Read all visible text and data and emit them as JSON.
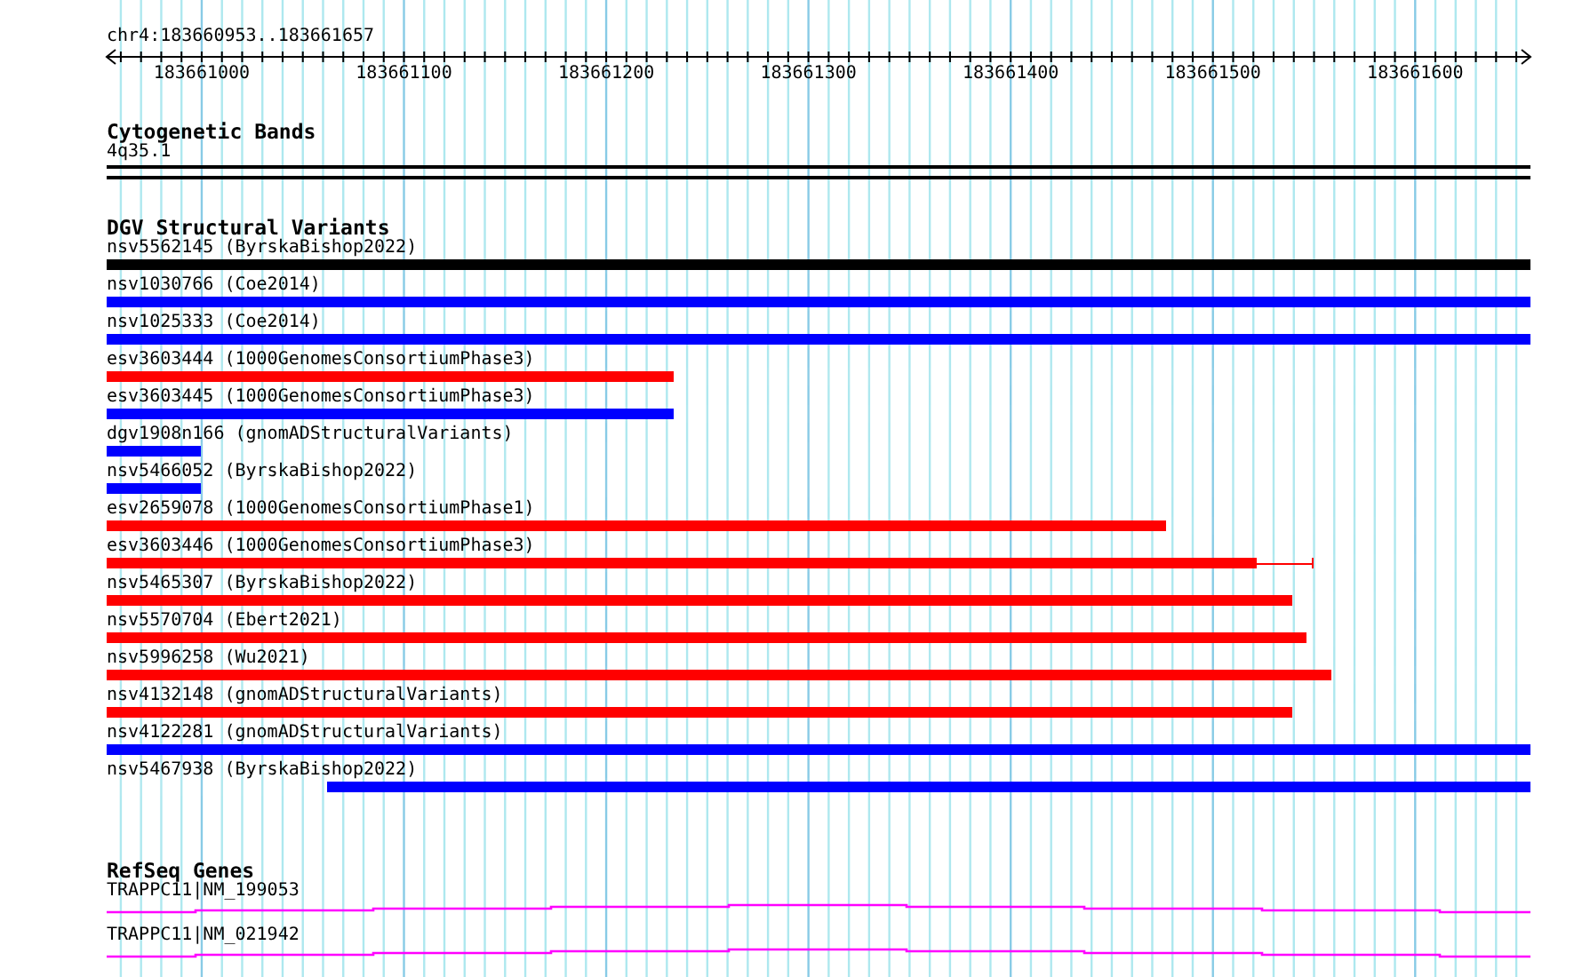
{
  "location": "chr4:183660953..183661657",
  "ruler": {
    "labels": [
      "183661000",
      "183661100",
      "183661200",
      "183661300",
      "183661400",
      "183661500",
      "183661600"
    ]
  },
  "tracks": [
    {
      "kind": "bands",
      "title": "Cytogenetic Bands",
      "bands": [
        {
          "name": "4q35.1"
        }
      ]
    },
    {
      "kind": "variants",
      "title": "DGV Structural Variants",
      "features": [
        {
          "label": "nsv5562145 (ByrskaBishop2022)",
          "color": "#000000",
          "kind": "bar",
          "level": 1
        },
        {
          "label": "nsv1030766 (Coe2014)",
          "color": "#0000ff",
          "kind": "bar",
          "level": 1
        },
        {
          "label": "nsv1025333 (Coe2014)",
          "color": "#0000ff",
          "kind": "bar",
          "level": 1
        },
        {
          "label": "esv3603444 (1000GenomesConsortiumPhase3)",
          "color": "#ff0000",
          "kind": "bar",
          "level": 0.398
        },
        {
          "label": "esv3603445 (1000GenomesConsortiumPhase3)",
          "color": "#0000ff",
          "kind": "bar",
          "level": 0.398
        },
        {
          "label": "dgv1908n166 (gnomADStructuralVariants)",
          "color": "#0000ff",
          "kind": "bar",
          "level": 0.066
        },
        {
          "label": "nsv5466052 (ByrskaBishop2022)",
          "color": "#0000ff",
          "kind": "bar",
          "level": 0.066
        },
        {
          "label": "esv2659078 (1000GenomesConsortiumPhase1)",
          "color": "#ff0000",
          "kind": "bar",
          "level": 0.744
        },
        {
          "label": "esv3603446 (1000GenomesConsortiumPhase3)",
          "color": "#ff0000",
          "kind": "bar",
          "level": 0.808,
          "tail": {
            "level": 0.848
          }
        },
        {
          "label": "nsv5465307 (ByrskaBishop2022)",
          "color": "#ff0000",
          "kind": "bar",
          "level": 0.833
        },
        {
          "label": "nsv5570704 (Ebert2021)",
          "color": "#ff0000",
          "kind": "bar",
          "level": 0.843
        },
        {
          "label": "nsv5996258 (Wu2021)",
          "color": "#ff0000",
          "kind": "bar",
          "level": 0.86
        },
        {
          "label": "nsv4132148 (gnomADStructuralVariants)",
          "color": "#ff0000",
          "kind": "bar",
          "level": 0.833
        },
        {
          "label": "nsv4122281 (gnomADStructuralVariants)",
          "color": "#0000ff",
          "kind": "bar",
          "level": 1
        },
        {
          "label": "nsv5467938 (ByrskaBishop2022)",
          "color": "#0000ff",
          "kind": "clipped",
          "level": 0.845
        }
      ]
    },
    {
      "kind": "genes",
      "title": "RefSeq Genes",
      "genes": [
        {
          "label": "TRAPPC11|NM_199053"
        },
        {
          "label": "TRAPPC11|NM_021942"
        }
      ]
    }
  ]
}
